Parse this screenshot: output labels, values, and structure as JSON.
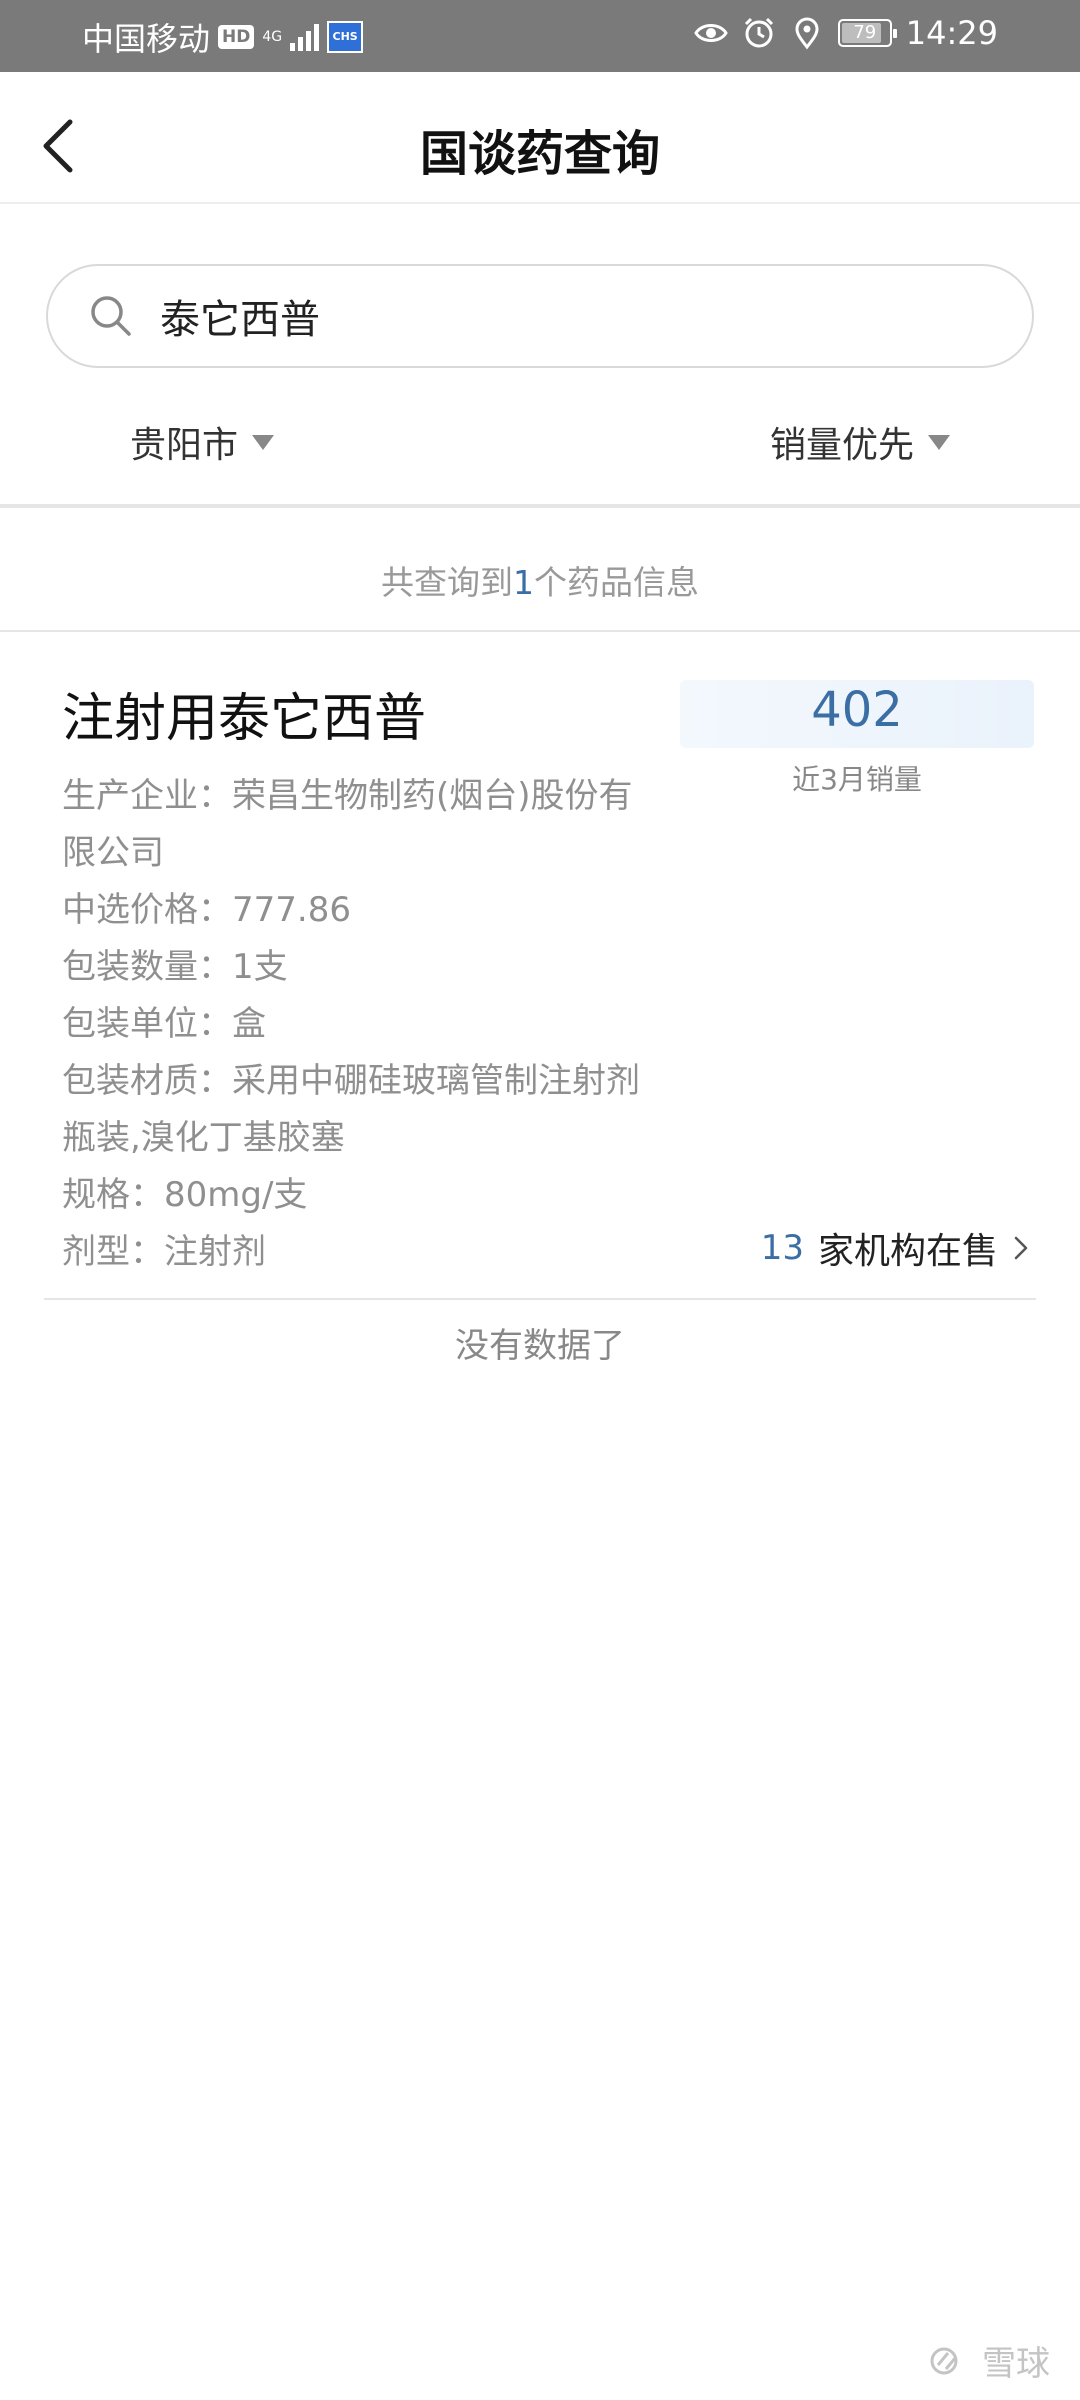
{
  "status_bar": {
    "carrier": "中国移动",
    "hd_badge": "HD",
    "network": "4G",
    "chs_badge": "CHS",
    "battery": "79",
    "time": "14:29"
  },
  "header": {
    "title": "国谈药查询"
  },
  "search": {
    "value": "泰它西普",
    "placeholder": ""
  },
  "filters": {
    "city": "贵阳市",
    "sort": "销量优先"
  },
  "result_summary": {
    "prefix": "共查询到",
    "count": "1",
    "suffix": "个药品信息"
  },
  "drug": {
    "name": "注射用泰它西普",
    "sales_value": "402",
    "sales_label": "近3月销量",
    "info": [
      "生产企业：荣昌生物制药(烟台)股份有",
      "限公司",
      "中选价格：777.86",
      "包装数量：1支",
      "包装单位：盒",
      "包装材质：采用中硼硅玻璃管制注射剂",
      "瓶装,溴化丁基胶塞",
      "规格：80mg/支",
      "剂型：注射剂"
    ],
    "sellers_count": "13",
    "sellers_label": "家机构在售"
  },
  "footer_note": "没有数据了",
  "watermark": "雪球"
}
